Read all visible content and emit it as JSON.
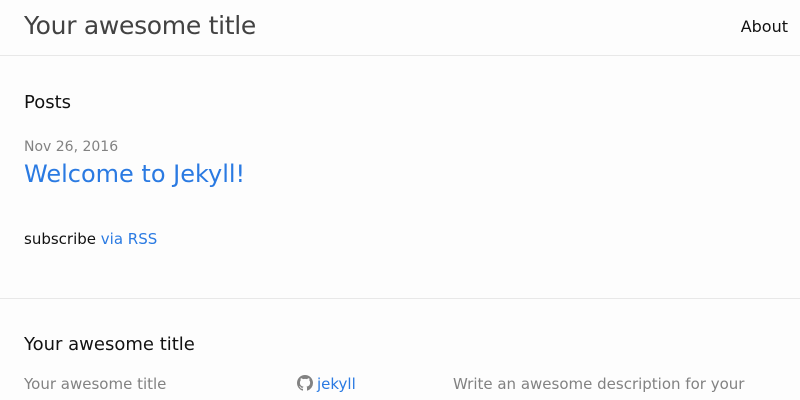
{
  "header": {
    "site_title": "Your awesome title",
    "nav": [
      {
        "label": "About"
      }
    ]
  },
  "main": {
    "posts_heading": "Posts",
    "posts": [
      {
        "date": "Nov 26, 2016",
        "title": "Welcome to Jekyll!"
      }
    ],
    "rss": {
      "prefix": "subscribe",
      "link_label": "via RSS"
    }
  },
  "footer": {
    "heading": "Your awesome title",
    "col1_title": "Your awesome title",
    "github_label": "jekyll",
    "description": "Write an awesome description for your"
  },
  "colors": {
    "link": "#2a7ae2",
    "muted": "#828282",
    "title": "#424242",
    "divider": "#e8e8e8",
    "background": "#fdfdfd"
  },
  "icons": {
    "github": "github-icon"
  }
}
